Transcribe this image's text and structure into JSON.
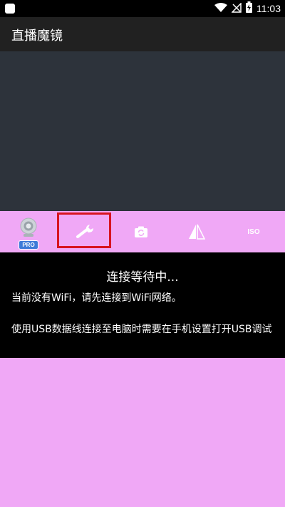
{
  "status_bar": {
    "time": "11:03",
    "icons": [
      "notification-square-icon",
      "wifi-icon",
      "no-signal-icon",
      "battery-charging-icon"
    ]
  },
  "app_bar": {
    "title": "直播魔镜"
  },
  "toolbar": {
    "items": [
      {
        "icon": "webcam-icon",
        "badge": "PRO"
      },
      {
        "icon": "wrench-icon",
        "highlighted": true
      },
      {
        "icon": "camera-switch-icon"
      },
      {
        "icon": "mirror-flip-icon"
      },
      {
        "icon": "iso-icon",
        "label": "ISO"
      }
    ]
  },
  "info": {
    "title": "连接等待中...",
    "wifi_message": "当前没有WiFi，请先连接到WiFi网络。",
    "usb_message": "使用USB数据线连接至电脑时需要在手机设置打开USB调试"
  },
  "colors": {
    "toolbar_bg": "#f0a8f6",
    "preview_bg": "#2d333b",
    "highlight": "#d8141f",
    "badge": "#3d7bd8"
  }
}
